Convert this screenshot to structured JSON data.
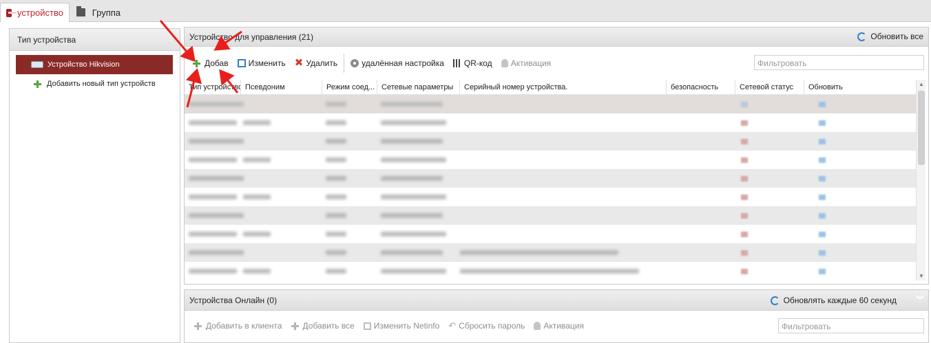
{
  "tabs": [
    {
      "label": "устройство",
      "icon": "device-icon",
      "active": true
    },
    {
      "label": "Группа",
      "icon": "folder-icon",
      "active": false
    }
  ],
  "left_panel": {
    "title": "Тип устройства",
    "selected_item": "Устройство Hikvision",
    "add_item": "Добавить новый тип устройств"
  },
  "managed_panel": {
    "title": "Устройство для управления (21)",
    "refresh_all": "Обновить все",
    "toolbar": {
      "add": "Добав",
      "edit": "Изменить",
      "delete": "Удалить",
      "remote_config": "удалённая настройка",
      "qr": "QR-код",
      "activate": "Активация",
      "filter_placeholder": "Фильтровать"
    },
    "columns": [
      "Тип устройство...",
      "Псевдоним",
      "Режим соед...",
      "Сетевые параметры",
      "Серийный номер устройства.",
      "безопасность",
      "Сетевой статус",
      "Обновить"
    ]
  },
  "online_panel": {
    "title": "Устройства Онлайн (0)",
    "refresh": "Обновлять каждые 60 секунд",
    "toolbar": {
      "add_to_client": "Добавить в клиента",
      "add_all": "Добавить все",
      "edit_netinfo": "Изменить Netinfo",
      "reset_password": "Сбросить пароль",
      "activate": "Активация",
      "filter_placeholder": "Фильтровать"
    }
  },
  "colors": {
    "accent": "#c0272d",
    "selected": "#8a2a26",
    "annotation": "#e8201c"
  }
}
